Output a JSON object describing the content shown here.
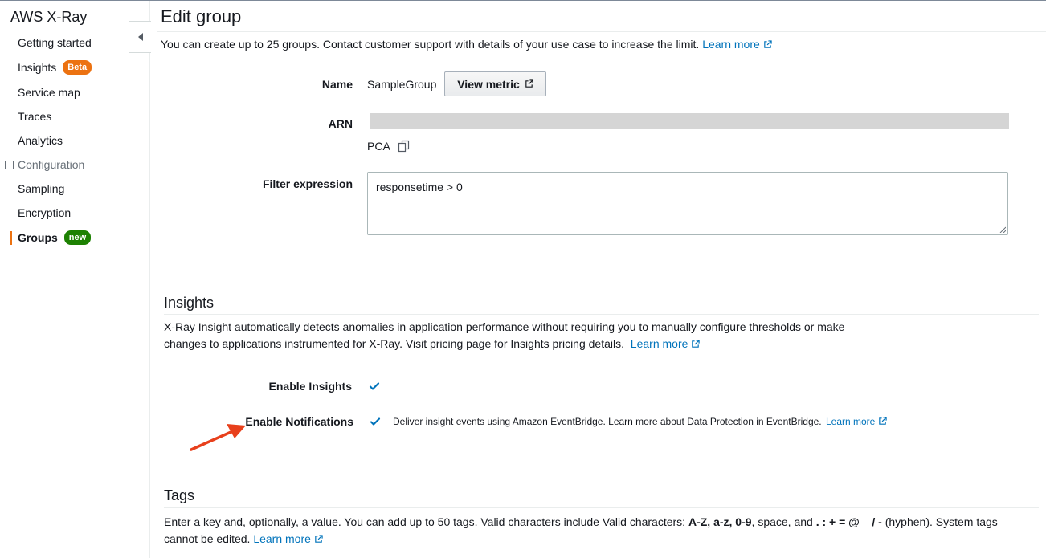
{
  "sidebar": {
    "title": "AWS X-Ray",
    "items": [
      {
        "label": "Getting started"
      },
      {
        "label": "Insights",
        "badge": "Beta"
      },
      {
        "label": "Service map"
      },
      {
        "label": "Traces"
      },
      {
        "label": "Analytics"
      }
    ],
    "section": "Configuration",
    "config_items": [
      {
        "label": "Sampling"
      },
      {
        "label": "Encryption"
      },
      {
        "label": "Groups",
        "badge": "new",
        "active": true
      }
    ]
  },
  "page": {
    "title": "Edit group",
    "intro": "You can create up to 25 groups. Contact customer support with details of your use case to increase the limit.",
    "learn_more": "Learn more"
  },
  "form": {
    "name_label": "Name",
    "name_value": "SampleGroup",
    "view_metric_label": "View metric",
    "arn_label": "ARN",
    "pca_text": "PCA",
    "filter_label": "Filter expression",
    "filter_value": "responsetime > 0"
  },
  "insights": {
    "title": "Insights",
    "line1": "X-Ray Insight automatically detects anomalies in application performance without requiring you to manually configure thresholds or make",
    "line2": "changes to applications instrumented for X-Ray. Visit pricing page for Insights pricing details.",
    "learn_more": "Learn more",
    "enable_insights_label": "Enable Insights",
    "enable_insights_checked": true,
    "enable_notifications_label": "Enable Notifications",
    "enable_notifications_checked": true,
    "notifications_desc": "Deliver insight events using Amazon EventBridge. Learn more about Data Protection in EventBridge.",
    "notifications_learn_more": "Learn more"
  },
  "tags": {
    "title": "Tags",
    "line1_a": "Enter a key and, optionally, a value. You can add up to 50 tags. Valid characters include Valid characters: ",
    "line1_b": "A-Z, a-z, 0-9",
    "line1_c": ", space, and ",
    "line1_d": ". : + = @ _ / -",
    "line1_e": " (hyphen). System tags",
    "line2": "cannot be edited.",
    "learn_more": "Learn more"
  },
  "colors": {
    "link": "#0073bb",
    "beta_badge": "#ec7211",
    "new_badge": "#1d8102",
    "checkbox": "#0073bb",
    "annotation_arrow": "#e8401c"
  },
  "icons": [
    "collapse-left-icon",
    "external-link-icon",
    "copy-icon",
    "checkmark-icon",
    "annotation-arrow"
  ]
}
